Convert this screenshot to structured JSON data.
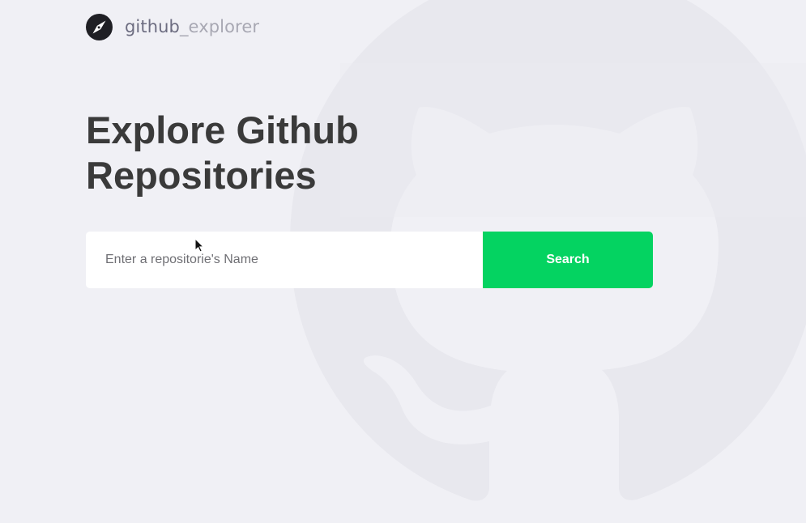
{
  "header": {
    "logo_icon": "compass-icon",
    "brand_primary": "github",
    "brand_secondary": "_explorer"
  },
  "hero": {
    "title": "Explore Github Repositories"
  },
  "search": {
    "placeholder": "Enter a repositorie's Name",
    "value": "",
    "button_label": "Search"
  },
  "background": {
    "watermark_icon": "github-octocat-icon"
  },
  "overlay": {
    "cursor_icon": "mouse-pointer-icon"
  },
  "colors": {
    "page_background": "#f0f0f5",
    "brand_primary": "#6c6c80",
    "brand_secondary": "#a8a8b3",
    "title": "#3a3a3a",
    "button": "#04d361"
  }
}
